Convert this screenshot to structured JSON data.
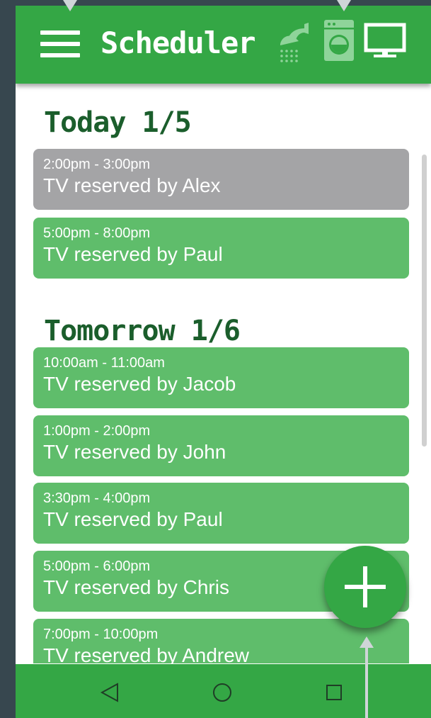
{
  "app_bar": {
    "title": "Scheduler",
    "menu_icon": "hamburger-menu-icon",
    "device_icons": [
      "shower-icon",
      "washer-icon",
      "tv-icon"
    ],
    "selected_device": "tv-icon"
  },
  "sections": [
    {
      "title": "Today 1/5",
      "reservations": [
        {
          "time": "2:00pm - 3:00pm",
          "label": "TV reserved by Alex",
          "status": "past"
        },
        {
          "time": "5:00pm - 8:00pm",
          "label": "TV reserved by Paul",
          "status": "upcoming"
        }
      ]
    },
    {
      "title": "Tomorrow 1/6",
      "reservations": [
        {
          "time": "10:00am - 11:00am",
          "label": "TV reserved by Jacob",
          "status": "upcoming"
        },
        {
          "time": "1:00pm - 2:00pm",
          "label": "TV reserved by John",
          "status": "upcoming"
        },
        {
          "time": "3:30pm - 4:00pm",
          "label": "TV reserved by Paul",
          "status": "upcoming"
        },
        {
          "time": "5:00pm - 6:00pm",
          "label": "TV reserved by Chris",
          "status": "upcoming"
        },
        {
          "time": "7:00pm - 10:00pm",
          "label": "TV reserved by Andrew",
          "status": "upcoming"
        }
      ]
    }
  ],
  "fab": {
    "icon": "plus-icon"
  },
  "nav_bar": {
    "icons": [
      "back-triangle-icon",
      "home-circle-icon",
      "recents-square-icon"
    ]
  },
  "colors": {
    "primary": "#34a745",
    "card_upcoming": "#5fbd6b",
    "card_past": "#a4a4a6",
    "section_title": "#1b5e2c",
    "inactive_icon": "#8fd49a"
  }
}
